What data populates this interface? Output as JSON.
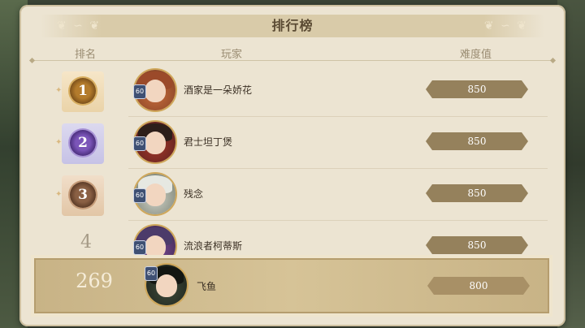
{
  "title": "排行榜",
  "columns": {
    "rank": "排名",
    "player": "玩家",
    "score": "难度值"
  },
  "rows": [
    {
      "rank": "1",
      "medal": "gold",
      "level": "60",
      "name": "酒家是一朵娇花",
      "score": "850"
    },
    {
      "rank": "2",
      "medal": "purple",
      "level": "60",
      "name": "君士坦丁煲",
      "score": "850"
    },
    {
      "rank": "3",
      "medal": "bronze",
      "level": "60",
      "name": "残念",
      "score": "850"
    },
    {
      "rank": "4",
      "medal": "none",
      "level": "60",
      "name": "流浪者柯蒂斯",
      "score": "850"
    }
  ],
  "self": {
    "rank": "269",
    "level": "60",
    "name": "飞鱼",
    "score": "800"
  },
  "colors": {
    "panel": "#ece4d2",
    "score_bar": "#95815c",
    "gold": "#b37b2c",
    "purple": "#7b55b8",
    "bronze": "#8a6044"
  }
}
